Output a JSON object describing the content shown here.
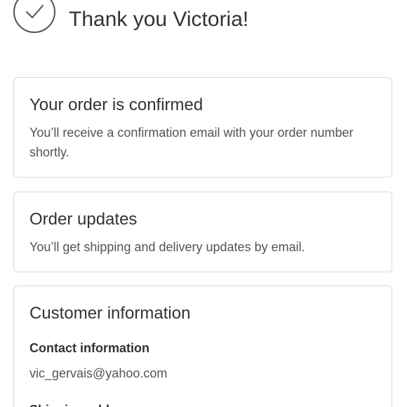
{
  "header": {
    "check_icon": "check-circle-icon",
    "order_number": "",
    "greeting": "Thank you Victoria!"
  },
  "confirmation_card": {
    "title": "Your order is confirmed",
    "body": "You’ll receive a confirmation email with your order number shortly."
  },
  "updates_card": {
    "title": "Order updates",
    "body": "You’ll get shipping and delivery updates by email."
  },
  "customer_card": {
    "title": "Customer information",
    "contact_label": "Contact information",
    "contact_value": "vic_gervais@yahoo.com",
    "shipping_label": "Shipping address"
  },
  "colors": {
    "text": "#333333",
    "muted": "#545454",
    "border": "#d9d9d9",
    "icon": "#5c4a5e"
  }
}
